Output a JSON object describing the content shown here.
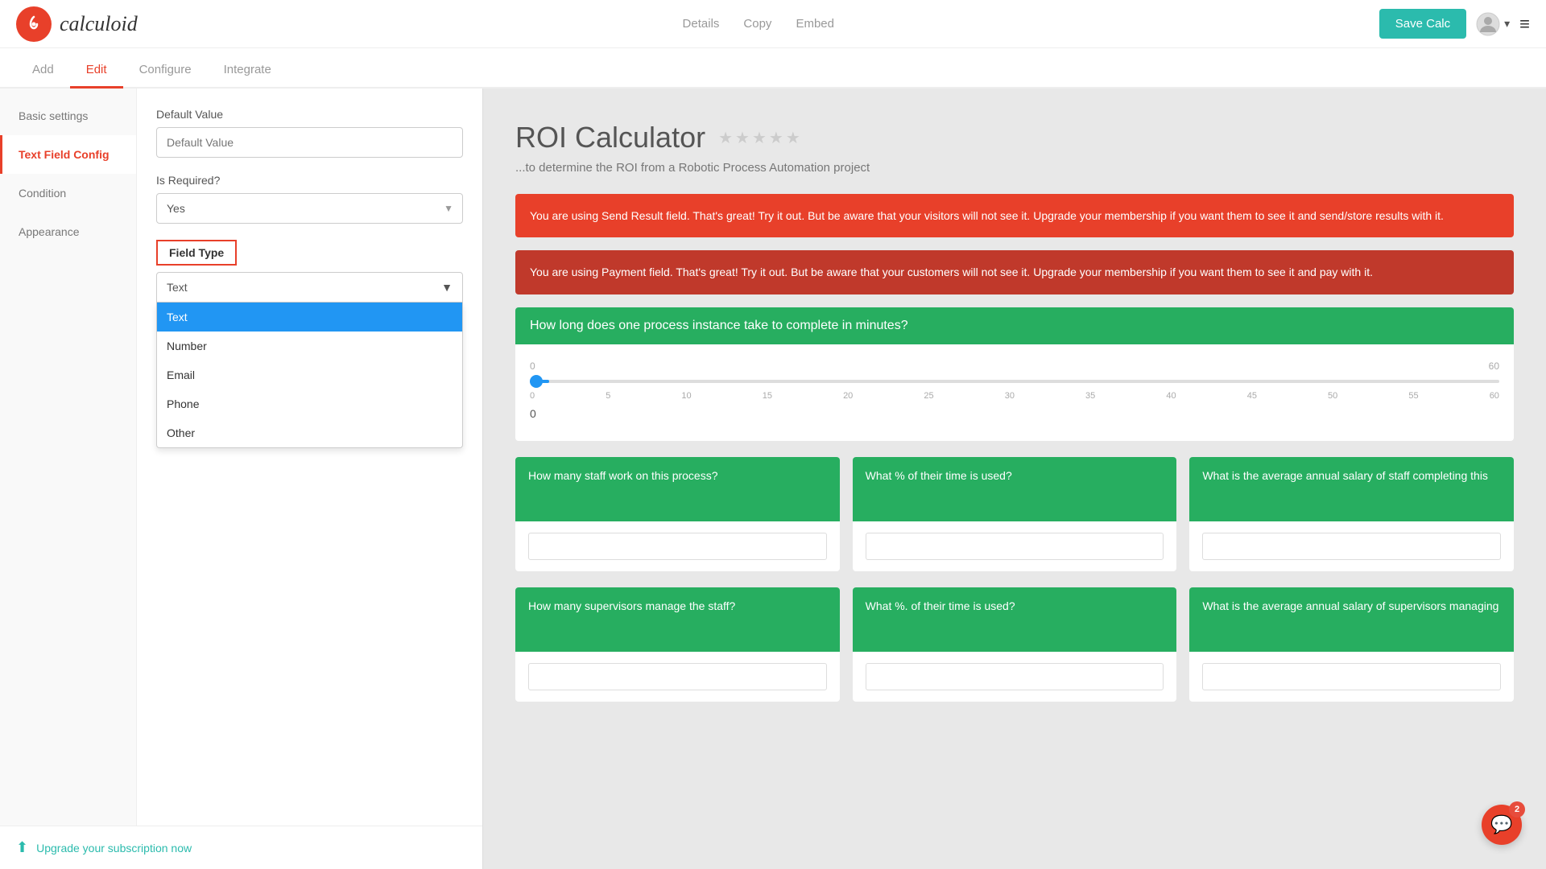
{
  "header": {
    "logo_text": "calculoid",
    "logo_icon": "©",
    "nav": {
      "details": "Details",
      "copy": "Copy",
      "embed": "Embed"
    },
    "save_button": "Save Calc"
  },
  "tabs": [
    {
      "id": "add",
      "label": "Add",
      "active": false
    },
    {
      "id": "edit",
      "label": "Edit",
      "active": true
    },
    {
      "id": "configure",
      "label": "Configure",
      "active": false
    },
    {
      "id": "integrate",
      "label": "Integrate",
      "active": false
    }
  ],
  "sidebar": {
    "items": [
      {
        "id": "basic-settings",
        "label": "Basic settings",
        "active": false
      },
      {
        "id": "text-field-config",
        "label": "Text Field Config",
        "active": true
      },
      {
        "id": "condition",
        "label": "Condition",
        "active": false
      },
      {
        "id": "appearance",
        "label": "Appearance",
        "active": false
      }
    ]
  },
  "form": {
    "default_value_label": "Default Value",
    "default_value_placeholder": "Default Value",
    "is_required_label": "Is Required?",
    "is_required_value": "Yes",
    "field_type_label": "Field Type",
    "field_type_value": "Text",
    "field_type_options": [
      {
        "id": "text",
        "label": "Text",
        "selected": true
      },
      {
        "id": "number",
        "label": "Number",
        "selected": false
      },
      {
        "id": "email",
        "label": "Email",
        "selected": false
      },
      {
        "id": "phone",
        "label": "Phone",
        "selected": false
      },
      {
        "id": "other",
        "label": "Other",
        "selected": false
      }
    ]
  },
  "upgrade": {
    "label": "Upgrade your subscription now"
  },
  "calculator": {
    "title": "ROI Calculator",
    "subtitle": "...to determine the ROI from a Robotic Process Automation project",
    "alert1": "You are using Send Result field. That's great! Try it out. But be aware that your visitors will not see it. Upgrade your membership if you want them to see it and send/store results with it.",
    "alert2": "You are using Payment field. That's great! Try it out. But be aware that your customers will not see it. Upgrade your membership if you want them to see it and pay with it.",
    "question1": {
      "label": "How long does one process instance take to complete in minutes?",
      "slider_min": "0",
      "slider_max": "60",
      "slider_value": "0",
      "tick_labels": [
        "0",
        "5",
        "10",
        "15",
        "20",
        "25",
        "30",
        "35",
        "40",
        "45",
        "50",
        "55",
        "60"
      ]
    },
    "question2": {
      "label": "How many staff work on this process?"
    },
    "question3": {
      "label": "What % of their time is used?"
    },
    "question4": {
      "label": "What is the average annual salary of staff completing this"
    },
    "question5": {
      "label": "How many supervisors manage the staff?"
    },
    "question6": {
      "label": "What %. of their time is used?"
    },
    "question7": {
      "label": "What is the average annual salary of supervisors managing"
    }
  },
  "chat": {
    "badge": "2"
  },
  "colors": {
    "accent": "#e8402a",
    "teal": "#2bbbad",
    "green": "#27ae60",
    "blue": "#2196F3"
  }
}
